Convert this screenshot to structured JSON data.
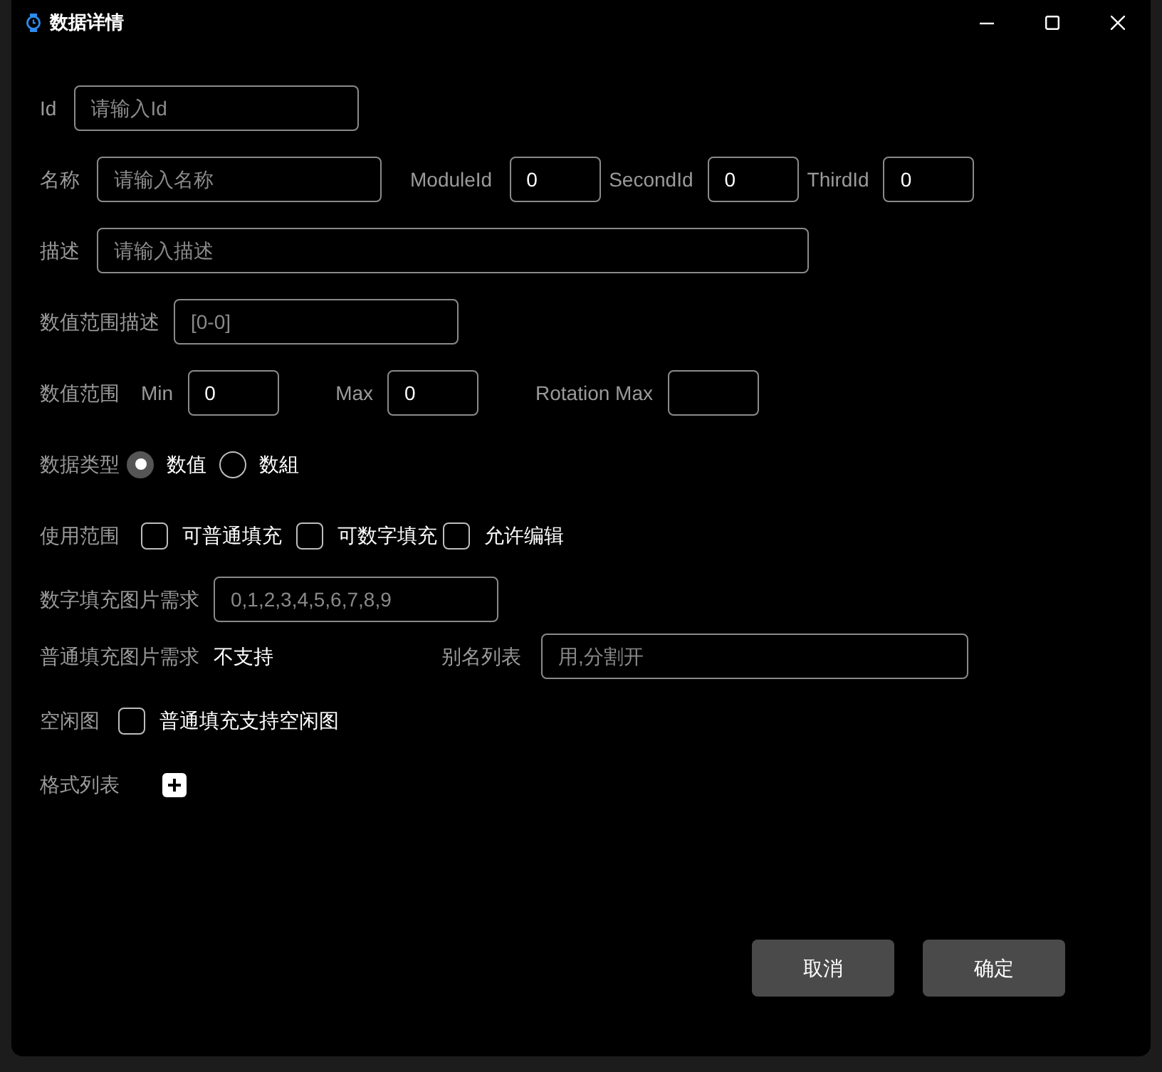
{
  "window": {
    "title": "数据详情"
  },
  "rows": [
    {
      "items": [
        {
          "kind": "label",
          "text": "Id"
        },
        {
          "kind": "input",
          "placeholder": "请输入Id"
        }
      ]
    },
    {
      "items": [
        {
          "kind": "label",
          "text": "名称"
        },
        {
          "kind": "input",
          "placeholder": "请输入名称"
        },
        {
          "kind": "label",
          "text": "ModuleId"
        },
        {
          "kind": "input",
          "value": "0"
        },
        {
          "kind": "label",
          "text": "SecondId"
        },
        {
          "kind": "input",
          "value": "0"
        },
        {
          "kind": "label",
          "text": "ThirdId"
        },
        {
          "kind": "input",
          "value": "0"
        }
      ]
    },
    {
      "items": [
        {
          "kind": "label",
          "text": "描述"
        },
        {
          "kind": "input",
          "placeholder": "请输入描述"
        }
      ]
    },
    {
      "items": [
        {
          "kind": "label",
          "text": "数值范围描述"
        },
        {
          "kind": "input",
          "placeholder": "[0-0]"
        }
      ]
    },
    {
      "items": [
        {
          "kind": "label",
          "text": "数值范围"
        },
        {
          "kind": "label",
          "text": "Min"
        },
        {
          "kind": "input",
          "value": "0"
        },
        {
          "kind": "label",
          "text": "Max"
        },
        {
          "kind": "input",
          "value": "0"
        },
        {
          "kind": "label",
          "text": "Rotation Max"
        },
        {
          "kind": "input"
        }
      ]
    },
    {
      "items": [
        {
          "kind": "label",
          "text": "数据类型"
        },
        {
          "kind": "radio",
          "selected": true,
          "text": "数值"
        },
        {
          "kind": "radio",
          "selected": false,
          "text": "数組"
        }
      ]
    },
    {
      "items": [
        {
          "kind": "label",
          "text": "使用范围"
        },
        {
          "kind": "checkbox",
          "checked": false,
          "text": "可普通填充"
        },
        {
          "kind": "checkbox",
          "checked": false,
          "text": "可数字填充"
        },
        {
          "kind": "checkbox",
          "checked": false,
          "text": "允许编辑"
        }
      ]
    },
    {
      "items": [
        {
          "kind": "label",
          "text": "数字填充图片需求"
        },
        {
          "kind": "input",
          "placeholder": "0,1,2,3,4,5,6,7,8,9"
        }
      ]
    },
    {
      "items": [
        {
          "kind": "label",
          "text": "普通填充图片需求"
        },
        {
          "kind": "value",
          "text": "不支持"
        },
        {
          "kind": "label",
          "text": "别名列表"
        },
        {
          "kind": "input",
          "placeholder": "用,分割开"
        }
      ]
    },
    {
      "items": [
        {
          "kind": "label",
          "text": "空闲图"
        },
        {
          "kind": "checkbox",
          "checked": false,
          "text": "普通填充支持空闲图"
        }
      ]
    },
    {
      "items": [
        {
          "kind": "label",
          "text": "格式列表"
        },
        {
          "kind": "add"
        }
      ]
    }
  ],
  "buttons": [
    "取消",
    "确定"
  ]
}
